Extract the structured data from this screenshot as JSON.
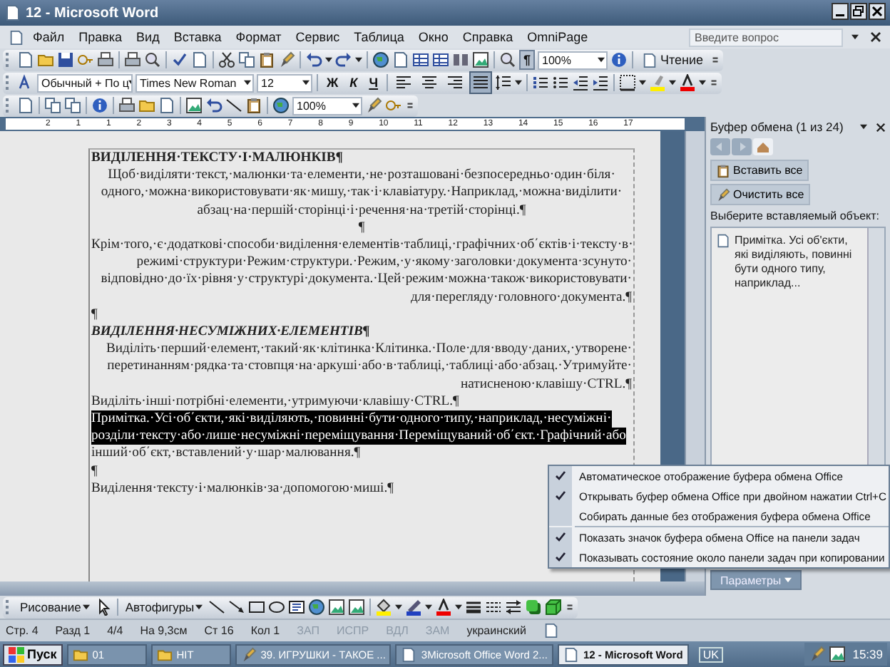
{
  "window": {
    "title": "12 - Microsoft Word"
  },
  "menu": [
    {
      "label": "Файл"
    },
    {
      "label": "Правка"
    },
    {
      "label": "Вид"
    },
    {
      "label": "Вставка"
    },
    {
      "label": "Формат"
    },
    {
      "label": "Сервис"
    },
    {
      "label": "Таблица"
    },
    {
      "label": "Окно"
    },
    {
      "label": "Справка"
    },
    {
      "label": "OmniPage"
    }
  ],
  "help_search": {
    "placeholder": "Введите вопрос"
  },
  "standard_toolbar": {
    "show_marks_button": {
      "label": "¶",
      "on": true
    },
    "zoom": "100%",
    "reading_button": "Чтение"
  },
  "formatting_toolbar": {
    "style": "Обычный + По ц",
    "font": "Times New Roman",
    "size": "12",
    "font_buttons": [
      {
        "label": "Ж",
        "kind": "bold"
      },
      {
        "label": "К",
        "kind": "italic"
      },
      {
        "label": "Ч",
        "kind": "underline"
      }
    ],
    "alignment_buttons": [
      {
        "kind": "left",
        "selected": false
      },
      {
        "kind": "center",
        "selected": false
      },
      {
        "kind": "right",
        "selected": false
      },
      {
        "kind": "justify",
        "selected": true
      }
    ]
  },
  "reviewing_toolbar": {
    "zoom": "100%"
  },
  "ruler": {
    "numbers": [
      "2",
      "1",
      "1",
      "2",
      "3",
      "4",
      "5",
      "6",
      "7",
      "8",
      "9",
      "10",
      "11",
      "12",
      "13",
      "14",
      "15",
      "16",
      "17"
    ]
  },
  "document": {
    "paragraphs": [
      {
        "kind": "heading",
        "text": "ВИДІЛЕННЯ·ТЕКСТУ·І·МАЛЮНКІВ¶"
      },
      {
        "kind": "centered",
        "text": "Щоб·виділяти·текст,·малюнки·та·елементи,·не·розташовані·безпосередньо·один·біля· одного,·можна·використовувати·як·мишу,·так·і·клавіатуру.·Наприклад,·можна·виділити· абзац·на·першій·сторінці·і·речення·на·третій·сторінці.¶"
      },
      {
        "kind": "centered",
        "text": "¶"
      },
      {
        "kind": "right",
        "text": "Крім·того,·є·додаткові·способи·виділення·елементів·таблиці,·графічних·об΄єктів·і·тексту·в· режимі·структури·Режим·структури.·Режим,·у·якому·заголовки·документа·зсунуто· відповідно·до·їх·рівня·у·структурі·документа.·Цей·режим·можна·також·використовувати· для·перегляду·головного·документа.¶"
      },
      {
        "kind": "plain",
        "text": "¶"
      },
      {
        "kind": "subheading",
        "text": "ВИДІЛЕННЯ·НЕСУМІЖНИХ·ЕЛЕМЕНТІВ¶"
      },
      {
        "kind": "right",
        "text": "Виділіть·перший·елемент,·такий·як·клітинка·Клітинка.·Поле·для·вводу·даних,·утворене· перетинанням·рядка·та·стовпця·на·аркуші·або·в·таблиці,·таблиці·або·абзац.·Утримуйте· натисненою·клавішу·CTRL.¶"
      },
      {
        "kind": "plain",
        "text": "Виділіть·інші·потрібні·елементи,·утримуючи·клавішу·CTRL.¶"
      },
      {
        "kind": "lines",
        "lines": [
          {
            "text": "Примітка.·Усі·об΄єкти,·які·виділяють,·повинні·бути·одного·типу,·наприклад,·несуміжні·",
            "selected": true
          },
          {
            "text": "розділи·тексту·або·лише·несуміжні·переміщування·Переміщуваний·об΄єкт.·Графічний·або",
            "selected": true
          },
          {
            "text": "інший·об΄єкт,·вставлений·у·шар·малювання.¶",
            "selected": false
          }
        ]
      },
      {
        "kind": "plain",
        "text": "¶"
      },
      {
        "kind": "plain",
        "text": "Виділення·тексту·і·малюнків·за·допомогою·миші.¶"
      }
    ]
  },
  "task_pane": {
    "title": "Буфер обмена (1 из 24)",
    "paste_all_button": "Вставить все",
    "clear_all_button": "Очистить все",
    "prompt": "Выберите вставляемый объект:",
    "items": [
      {
        "text": "Примітка. Усі об'єкти, які виділяють, повинні бути одного типу, наприклад..."
      }
    ],
    "options_button": "Параметры"
  },
  "options_menu": {
    "items": [
      {
        "label": "Автоматическое отображение буфера обмена Office",
        "checked": true,
        "separator_before": false
      },
      {
        "label": "Открывать буфер обмена Office при двойном нажатии Ctrl+C",
        "checked": true,
        "separator_before": false
      },
      {
        "label": "Собирать данные без отображения буфера обмена Office",
        "checked": false,
        "separator_before": false
      },
      {
        "label": "Показать значок буфера обмена Office на панели задач",
        "checked": true,
        "separator_before": true
      },
      {
        "label": "Показывать состояние около панели задач при копировании",
        "checked": true,
        "separator_before": false
      }
    ]
  },
  "drawing_toolbar": {
    "draw_menu": "Рисование",
    "autoshapes_menu": "Автофигуры"
  },
  "status_bar": {
    "fields": [
      {
        "text": "Стр. 4",
        "disabled": false
      },
      {
        "text": "Разд 1",
        "disabled": false
      },
      {
        "text": "4/4",
        "disabled": false
      },
      {
        "text": "На 9,3см",
        "disabled": false
      },
      {
        "text": "Ст 16",
        "disabled": false
      },
      {
        "text": "Кол 1",
        "disabled": false
      },
      {
        "text": "ЗАП",
        "disabled": true
      },
      {
        "text": "ИСПР",
        "disabled": true
      },
      {
        "text": "ВДЛ",
        "disabled": true
      },
      {
        "text": "ЗАМ",
        "disabled": true
      },
      {
        "text": "украинский",
        "disabled": false
      }
    ]
  },
  "taskbar": {
    "start": "Пуск",
    "buttons": [
      {
        "label": "01",
        "kind": "folder",
        "selected": false
      },
      {
        "label": "НІТ",
        "kind": "folder",
        "selected": false
      },
      {
        "label": "39. ИГРУШКИ - ТАКОЕ ...",
        "kind": "app",
        "selected": false
      },
      {
        "label": "3Microsoft Office Word 2...",
        "kind": "document",
        "selected": false
      },
      {
        "label": "12 - Microsoft Word",
        "kind": "document",
        "selected": true
      }
    ],
    "language": "UK",
    "time": "15:39"
  }
}
